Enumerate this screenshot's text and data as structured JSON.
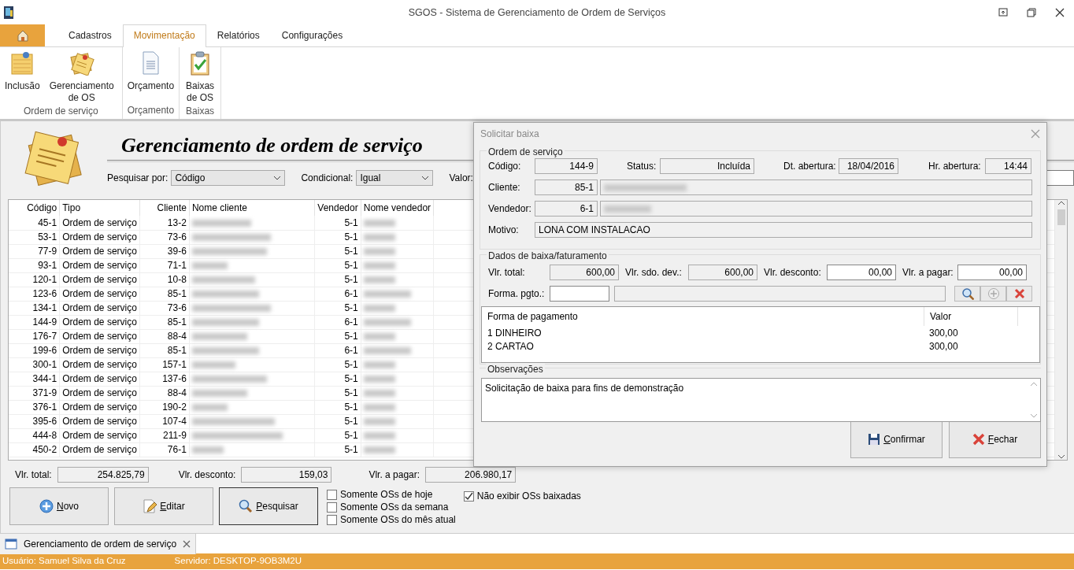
{
  "window": {
    "title": "SGOS - Sistema de Gerenciamento de Ordem de Serviços"
  },
  "ribbon": {
    "tabs": [
      {
        "label": "Cadastros",
        "selected": false
      },
      {
        "label": "Movimentação",
        "selected": true
      },
      {
        "label": "Relatórios",
        "selected": false
      },
      {
        "label": "Configurações",
        "selected": false
      }
    ],
    "groups": [
      {
        "label": "Ordem de serviço",
        "buttons": [
          {
            "label": "Inclusão"
          },
          {
            "label": "Gerenciamento de OS"
          }
        ]
      },
      {
        "label": "Orçamento",
        "buttons": [
          {
            "label": "Orçamento"
          }
        ]
      },
      {
        "label": "Baixas",
        "buttons": [
          {
            "label": "Baixas de OS"
          }
        ]
      }
    ]
  },
  "page": {
    "title": "Gerenciamento de ordem de serviço",
    "filters": [
      {
        "label": "Pesquisar por:",
        "value": "Código",
        "kind": "select"
      },
      {
        "label": "Condicional:",
        "value": "Igual",
        "kind": "select"
      },
      {
        "label": "Valor:",
        "kind": "text"
      }
    ],
    "table": {
      "columns": [
        "Código",
        "Tipo",
        "Cliente",
        "Nome cliente",
        "Vendedor",
        "Nome vendedor"
      ],
      "rows": [
        {
          "codigo": "45-1",
          "tipo": "Ordem de serviço",
          "cliente": "13-2",
          "vendedor": "5-1"
        },
        {
          "codigo": "53-1",
          "tipo": "Ordem de serviço",
          "cliente": "73-6",
          "vendedor": "5-1"
        },
        {
          "codigo": "77-9",
          "tipo": "Ordem de serviço",
          "cliente": "39-6",
          "vendedor": "5-1"
        },
        {
          "codigo": "93-1",
          "tipo": "Ordem de serviço",
          "cliente": "71-1",
          "vendedor": "5-1"
        },
        {
          "codigo": "120-1",
          "tipo": "Ordem de serviço",
          "cliente": "10-8",
          "vendedor": "5-1"
        },
        {
          "codigo": "123-6",
          "tipo": "Ordem de serviço",
          "cliente": "85-1",
          "vendedor": "6-1"
        },
        {
          "codigo": "134-1",
          "tipo": "Ordem de serviço",
          "cliente": "73-6",
          "vendedor": "5-1"
        },
        {
          "codigo": "144-9",
          "tipo": "Ordem de serviço",
          "cliente": "85-1",
          "vendedor": "6-1"
        },
        {
          "codigo": "176-7",
          "tipo": "Ordem de serviço",
          "cliente": "88-4",
          "vendedor": "5-1"
        },
        {
          "codigo": "199-6",
          "tipo": "Ordem de serviço",
          "cliente": "85-1",
          "vendedor": "6-1"
        },
        {
          "codigo": "300-1",
          "tipo": "Ordem de serviço",
          "cliente": "157-1",
          "vendedor": "5-1"
        },
        {
          "codigo": "344-1",
          "tipo": "Ordem de serviço",
          "cliente": "137-6",
          "vendedor": "5-1"
        },
        {
          "codigo": "371-9",
          "tipo": "Ordem de serviço",
          "cliente": "88-4",
          "vendedor": "5-1"
        },
        {
          "codigo": "376-1",
          "tipo": "Ordem de serviço",
          "cliente": "190-2",
          "vendedor": "5-1"
        },
        {
          "codigo": "395-6",
          "tipo": "Ordem de serviço",
          "cliente": "107-4",
          "vendedor": "5-1"
        },
        {
          "codigo": "444-8",
          "tipo": "Ordem de serviço",
          "cliente": "211-9",
          "vendedor": "5-1"
        },
        {
          "codigo": "450-2",
          "tipo": "Ordem de serviço",
          "cliente": "76-1",
          "vendedor": "5-1"
        }
      ]
    },
    "totals": [
      {
        "label": "Vlr. total:",
        "value": "254.825,79"
      },
      {
        "label": "Vlr. desconto:",
        "value": "159,03"
      },
      {
        "label": "Vlr. a pagar:",
        "value": "206.980,17"
      }
    ],
    "buttons": [
      {
        "label": "Novo",
        "selected": false
      },
      {
        "label": "Editar",
        "selected": false
      },
      {
        "label": "Pesquisar",
        "selected": true
      }
    ],
    "options": [
      {
        "label": "Somente OSs de hoje",
        "checked": false
      },
      {
        "label": "Somente OSs da semana",
        "checked": false
      },
      {
        "label": "Somente OSs do mês atual",
        "checked": false
      },
      {
        "label": "Não exibir OSs baixadas",
        "checked": true
      }
    ]
  },
  "document_tabs": [
    {
      "label": "Gerenciamento de ordem de serviço",
      "selected": true
    }
  ],
  "status_bar": [
    "Usuário: Samuel Silva da Cruz",
    "Servidor: DESKTOP-9OB3M2U"
  ],
  "dialog": {
    "title": "Solicitar baixa",
    "order": {
      "legend": "Ordem de serviço",
      "codigo": {
        "label": "Código:",
        "value": "144-9"
      },
      "status": {
        "label": "Status:",
        "value": "Incluída"
      },
      "dt_abertura": {
        "label": "Dt. abertura:",
        "value": "18/04/2016"
      },
      "hr_abertura": {
        "label": "Hr. abertura:",
        "value": "14:44"
      },
      "cliente": {
        "label": "Cliente:",
        "value": "85-1"
      },
      "vendedor": {
        "label": "Vendedor:",
        "value": "6-1"
      },
      "motivo": {
        "label": "Motivo:",
        "value": "LONA COM INSTALACAO"
      }
    },
    "billing": {
      "legend": "Dados de baixa/faturamento",
      "fields": [
        {
          "label": "Vlr. total:",
          "value": "600,00",
          "editable": false
        },
        {
          "label": "Vlr. sdo. dev.:",
          "value": "600,00",
          "editable": false
        },
        {
          "label": "Vlr. desconto:",
          "value": "00,00",
          "editable": true
        },
        {
          "label": "Vlr. a pagar:",
          "value": "00,00",
          "editable": true
        }
      ],
      "forma_label": "Forma. pgto.:",
      "payments": {
        "columns": [
          "Forma de pagamento",
          "Valor"
        ],
        "rows": [
          [
            "1 DINHEIRO",
            "300,00"
          ],
          [
            "2 CARTAO",
            "300,00"
          ]
        ]
      }
    },
    "observations": {
      "legend": "Observações",
      "value": "Solicitação de baixa para fins de demonstração"
    },
    "buttons": [
      {
        "label": "Confirmar"
      },
      {
        "label": "Fechar"
      }
    ]
  }
}
